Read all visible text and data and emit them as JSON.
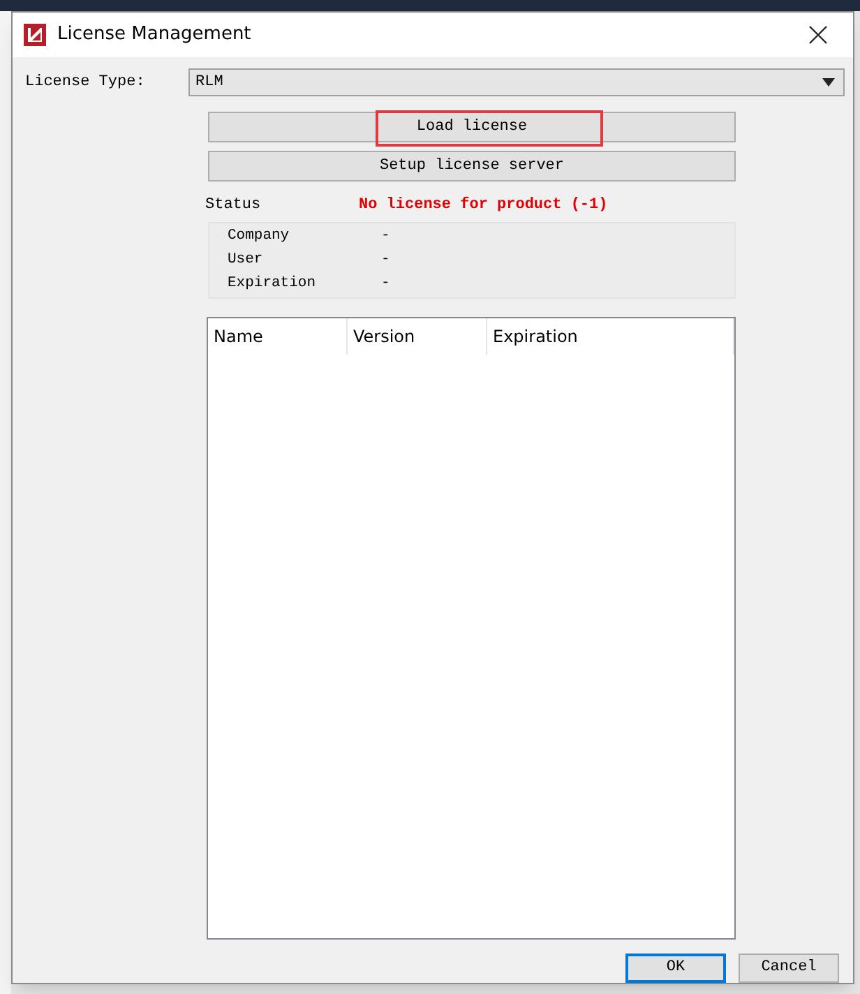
{
  "window": {
    "title": "License Management"
  },
  "license_type": {
    "label": "License Type:",
    "value": "RLM"
  },
  "actions": [
    {
      "label": "Load license",
      "highlighted": true
    },
    {
      "label": "Setup license server",
      "highlighted": false
    }
  ],
  "status": {
    "label": "Status",
    "value": "No license for product (-1)"
  },
  "details": [
    {
      "label": "Company",
      "value": "-"
    },
    {
      "label": "User",
      "value": "-"
    },
    {
      "label": "Expiration",
      "value": "-"
    }
  ],
  "table": {
    "columns": [
      "Name",
      "Version",
      "Expiration"
    ]
  },
  "buttons": [
    {
      "label": "OK",
      "default": true
    },
    {
      "label": "Cancel",
      "default": false
    }
  ]
}
